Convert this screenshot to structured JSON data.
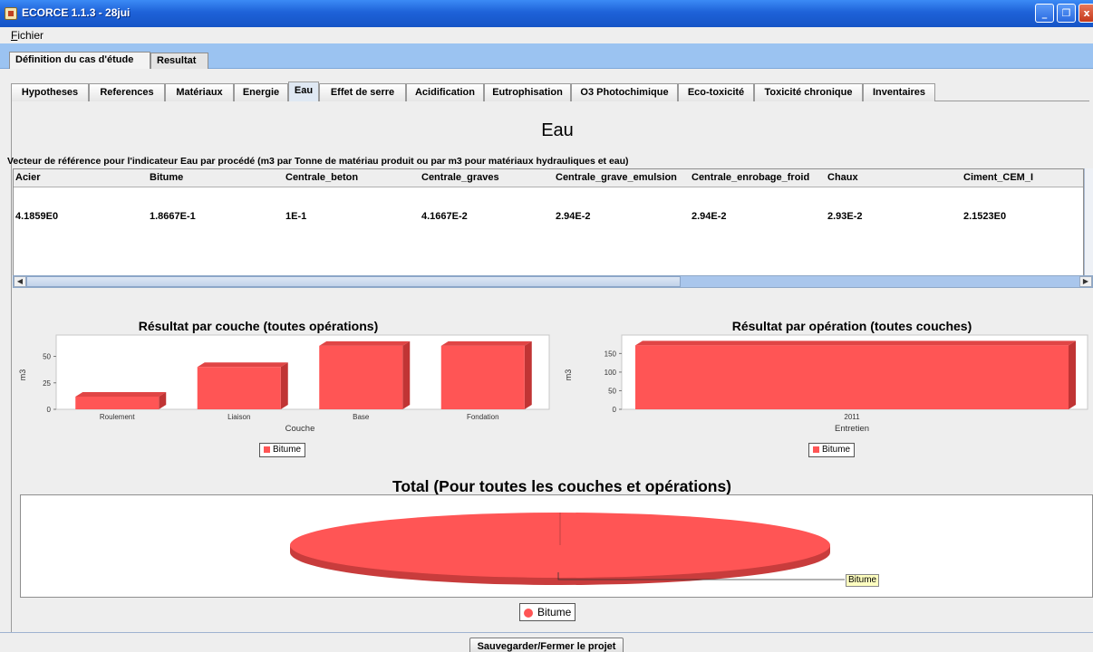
{
  "window": {
    "title": "ECORCE 1.1.3 - 28jui",
    "app_icon": "java-cup-icon"
  },
  "menu": {
    "fichier_mnemonic": "F",
    "fichier_rest": "ichier"
  },
  "top_tabs": [
    {
      "label": "Définition du cas d'étude",
      "active": true
    },
    {
      "label": "Resultat",
      "active": false
    }
  ],
  "inner_tabs": [
    {
      "label": "Hypotheses"
    },
    {
      "label": "References"
    },
    {
      "label": "Matériaux"
    },
    {
      "label": "Energie"
    },
    {
      "label": "Eau",
      "active": true
    },
    {
      "label": "Effet de serre"
    },
    {
      "label": "Acidification"
    },
    {
      "label": "Eutrophisation"
    },
    {
      "label": "O3 Photochimique"
    },
    {
      "label": "Eco-toxicité"
    },
    {
      "label": "Toxicité chronique"
    },
    {
      "label": "Inventaires"
    }
  ],
  "page_title": "Eau",
  "reference_caption": "Vecteur de référence pour l'indicateur Eau par procédé (m3 par Tonne de matériau produit ou par m3 pour matériaux hydrauliques et eau)",
  "table": {
    "columns": [
      "Acier",
      "Bitume",
      "Centrale_beton",
      "Centrale_graves",
      "Centrale_grave_emulsion",
      "Centrale_enrobage_froid",
      "Chaux",
      "Ciment_CEM_I"
    ],
    "row": [
      "4.1859E0",
      "1.8667E-1",
      "1E-1",
      "4.1667E-2",
      "2.94E-2",
      "2.94E-2",
      "2.93E-2",
      "2.1523E0"
    ]
  },
  "chart_data": [
    {
      "type": "bar",
      "title": "Résultat par couche (toutes opérations)",
      "xlabel": "Couche",
      "ylabel": "m3",
      "categories": [
        "Roulement",
        "Liaison",
        "Base",
        "Fondation"
      ],
      "series": [
        {
          "name": "Bitume",
          "values": [
            12,
            40,
            60,
            60
          ]
        }
      ],
      "ylim": [
        0,
        65
      ],
      "yticks": [
        "0",
        "25",
        "50"
      ],
      "legend": "bottom",
      "color": "#ff5555"
    },
    {
      "type": "bar",
      "title": "Résultat par opération (toutes couches)",
      "xlabel": "Entretien",
      "ylabel": "m3",
      "categories": [
        "2011"
      ],
      "series": [
        {
          "name": "Bitume",
          "values": [
            172
          ]
        }
      ],
      "ylim": [
        0,
        185
      ],
      "yticks": [
        "0",
        "50",
        "100",
        "150"
      ],
      "legend": "bottom",
      "color": "#ff5555"
    },
    {
      "type": "pie",
      "title": "Total (Pour toutes les couches et opérations)",
      "labels": [
        "Bitume"
      ],
      "values": [
        100
      ],
      "legend": "bottom",
      "color": "#ff5555"
    }
  ],
  "buttons": {
    "save": "Sauvegarder/Fermer le projet"
  },
  "window_buttons": {
    "minimize": "_",
    "maximize": "❐",
    "close": "x"
  }
}
